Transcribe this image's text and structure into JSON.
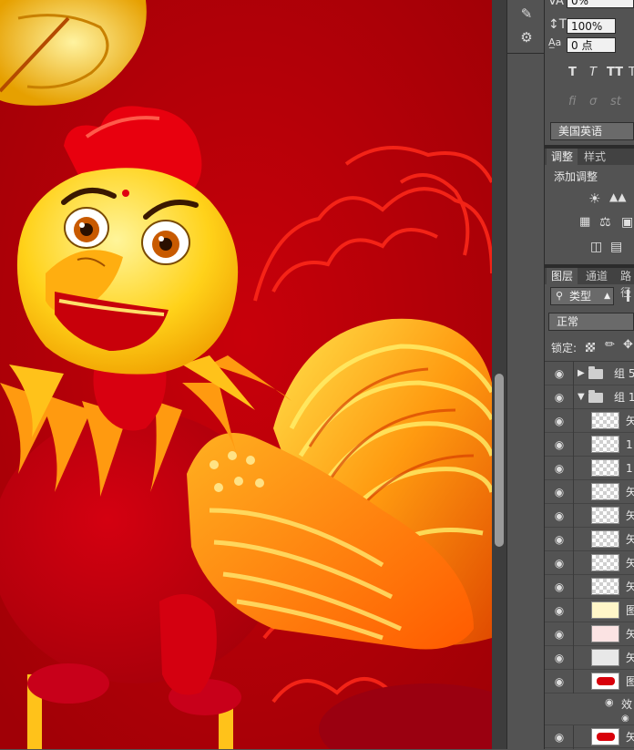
{
  "character_panel": {
    "tracking_value": "0%",
    "scale_value": "100%",
    "baseline_shift_value": "0 点",
    "style_buttons": [
      "T",
      "T",
      "TT",
      "T"
    ],
    "opentype_glyphs": [
      "fi",
      "σ",
      "st"
    ],
    "language": "美国英语"
  },
  "adjustments_panel": {
    "tabs": [
      "调整",
      "样式"
    ],
    "active_tab": "调整",
    "title": "添加调整"
  },
  "layers_panel": {
    "tabs": [
      "图层",
      "通道",
      "路径"
    ],
    "active_tab": "图层",
    "filter_kind": "类型",
    "blend_mode": "正常",
    "lock_label": "锁定:",
    "layers": [
      {
        "type": "group",
        "name": "组 5",
        "expanded": false
      },
      {
        "type": "group",
        "name": "组 1",
        "expanded": true
      },
      {
        "type": "layer",
        "name": "矢"
      },
      {
        "type": "layer",
        "name": "1"
      },
      {
        "type": "layer",
        "name": "1"
      },
      {
        "type": "layer",
        "name": "矢"
      },
      {
        "type": "layer",
        "name": "矢"
      },
      {
        "type": "layer",
        "name": "矢"
      },
      {
        "type": "layer",
        "name": "矢"
      },
      {
        "type": "layer",
        "name": "矢"
      },
      {
        "type": "layer",
        "name": "图"
      },
      {
        "type": "layer",
        "name": "矢"
      },
      {
        "type": "layer",
        "name": "矢"
      },
      {
        "type": "layer",
        "name": "图"
      }
    ],
    "effects_label": "效",
    "last_layer_name": "矢"
  },
  "colors": {
    "canvas_red": "#b80008",
    "panel_bg": "#535353",
    "panel_dark": "#2b2b2b"
  }
}
